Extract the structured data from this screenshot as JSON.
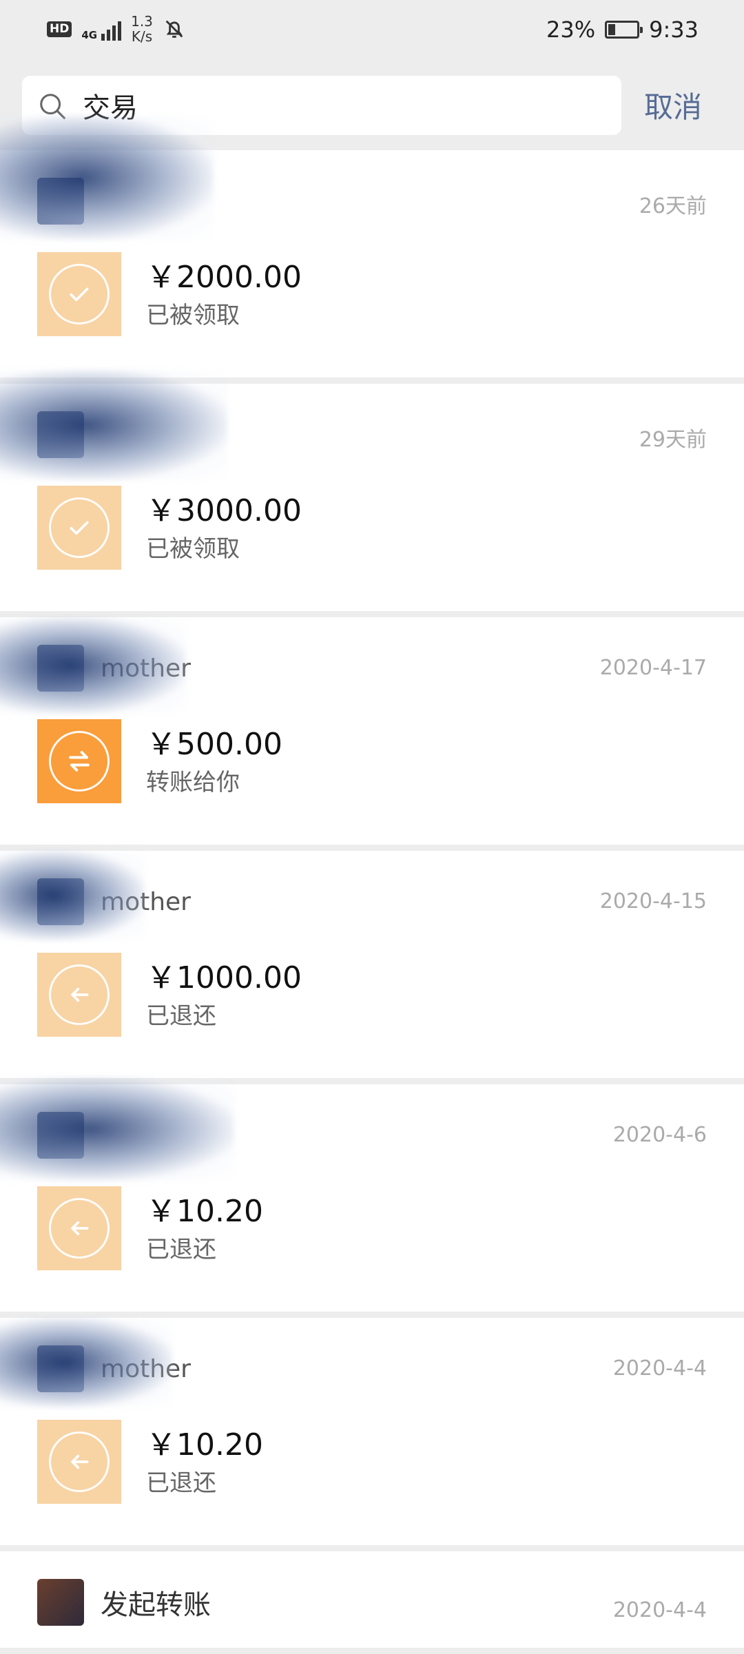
{
  "status_bar": {
    "hd_badge": "HD",
    "network": "4G",
    "speed_value": "1.3",
    "speed_unit": "K/s",
    "battery": "23%",
    "battery_level": 0.23,
    "time": "9:33"
  },
  "search": {
    "query": "交易",
    "cancel_label": "取消"
  },
  "colors": {
    "redpacket_done": "#f8d3a4",
    "transfer_active": "#fa9d3b",
    "link_blue": "#576b95"
  },
  "transactions": [
    {
      "sender": "",
      "time": "26天前",
      "amount": "￥2000.00",
      "status": "已被领取",
      "icon": "check-icon",
      "kind": "done"
    },
    {
      "sender": "",
      "time": "29天前",
      "amount": "￥3000.00",
      "status": "已被领取",
      "icon": "check-icon",
      "kind": "done"
    },
    {
      "sender": "mother",
      "time": "2020-4-17",
      "amount": "￥500.00",
      "status": "转账给你",
      "icon": "transfer-icon",
      "kind": "active"
    },
    {
      "sender": "mother",
      "time": "2020-4-15",
      "amount": "￥1000.00",
      "status": "已退还",
      "icon": "return-arrow-icon",
      "kind": "done"
    },
    {
      "sender": "",
      "time": "2020-4-6",
      "amount": "￥10.20",
      "status": "已退还",
      "icon": "return-arrow-icon",
      "kind": "done"
    },
    {
      "sender": "mother",
      "time": "2020-4-4",
      "amount": "￥10.20",
      "status": "已退还",
      "icon": "return-arrow-icon",
      "kind": "done"
    }
  ],
  "last_item": {
    "sender": "发起转账",
    "time": "2020-4-4"
  }
}
